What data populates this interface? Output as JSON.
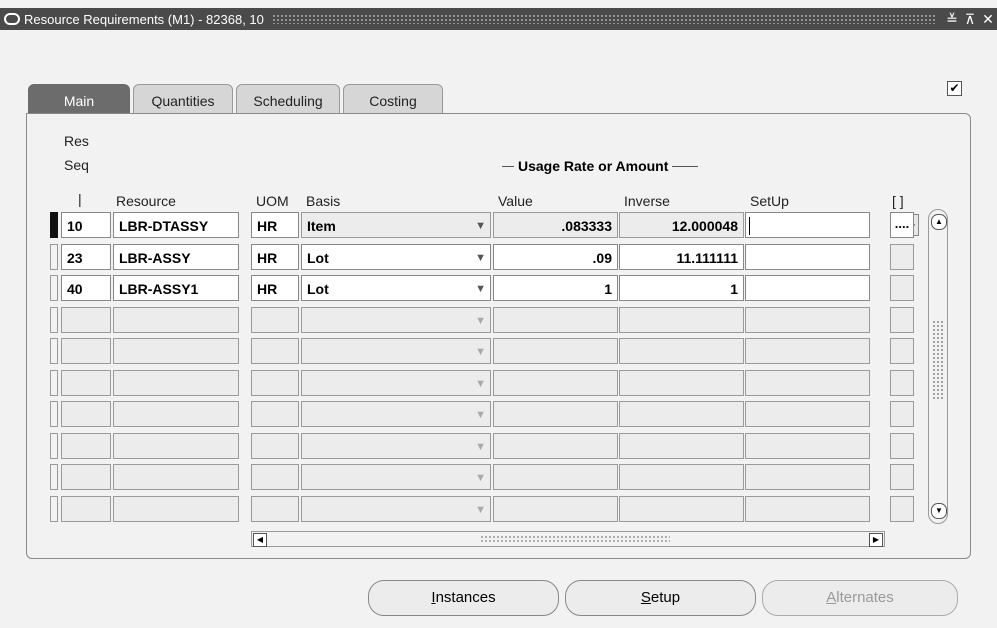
{
  "window": {
    "title": "Resource Requirements (M1) - 82368, 10"
  },
  "tabs": [
    {
      "label": "Main",
      "active": true
    },
    {
      "label": "Quantities",
      "active": false
    },
    {
      "label": "Scheduling",
      "active": false
    },
    {
      "label": "Costing",
      "active": false
    }
  ],
  "columns": {
    "res_seq_line1": "Res",
    "res_seq_line2": "Seq",
    "resource": "Resource",
    "uom": "UOM",
    "basis": "Basis",
    "group_label": "Usage Rate or Amount",
    "value": "Value",
    "inverse": "Inverse",
    "setup": "SetUp",
    "ext": "[ ]",
    "seq_marker": "|"
  },
  "rows": [
    {
      "seq": "10",
      "resource": "LBR-DTASSY",
      "uom": "HR",
      "basis": "Item",
      "value": ".083333",
      "inverse": "12.000048",
      "setup": "",
      "ext": "....",
      "current": true
    },
    {
      "seq": "23",
      "resource": "LBR-ASSY",
      "uom": "HR",
      "basis": "Lot",
      "value": ".09",
      "inverse": "11.111111",
      "setup": "",
      "ext": "",
      "current": false
    },
    {
      "seq": "40",
      "resource": "LBR-ASSY1",
      "uom": "HR",
      "basis": "Lot",
      "value": "1",
      "inverse": "1",
      "setup": "",
      "ext": "",
      "current": false
    },
    {
      "seq": "",
      "resource": "",
      "uom": "",
      "basis": "",
      "value": "",
      "inverse": "",
      "setup": "",
      "ext": "",
      "current": false
    },
    {
      "seq": "",
      "resource": "",
      "uom": "",
      "basis": "",
      "value": "",
      "inverse": "",
      "setup": "",
      "ext": "",
      "current": false
    },
    {
      "seq": "",
      "resource": "",
      "uom": "",
      "basis": "",
      "value": "",
      "inverse": "",
      "setup": "",
      "ext": "",
      "current": false
    },
    {
      "seq": "",
      "resource": "",
      "uom": "",
      "basis": "",
      "value": "",
      "inverse": "",
      "setup": "",
      "ext": "",
      "current": false
    },
    {
      "seq": "",
      "resource": "",
      "uom": "",
      "basis": "",
      "value": "",
      "inverse": "",
      "setup": "",
      "ext": "",
      "current": false
    },
    {
      "seq": "",
      "resource": "",
      "uom": "",
      "basis": "",
      "value": "",
      "inverse": "",
      "setup": "",
      "ext": "",
      "current": false
    },
    {
      "seq": "",
      "resource": "",
      "uom": "",
      "basis": "",
      "value": "",
      "inverse": "",
      "setup": "",
      "ext": "",
      "current": false
    }
  ],
  "buttons": {
    "instances": {
      "pre": "",
      "key": "I",
      "post": "nstances"
    },
    "setup": {
      "pre": "",
      "key": "S",
      "post": "etup"
    },
    "alternates": {
      "pre": "",
      "key": "A",
      "post": "lternates"
    }
  },
  "icons": {
    "window": "window-icon",
    "minimize": "minimize-icon",
    "maximize": "maximize-icon",
    "close": "close-icon",
    "checkbox": "checkbox-checked-icon",
    "dropdown": "dropdown-arrow-icon",
    "lov": "list-of-values-icon"
  },
  "glyphs": {
    "minimize": "≚",
    "maximize": "⊼",
    "close": "✕",
    "check": "✔",
    "dropdown": "▼",
    "lov": "···",
    "scroll_up": "▲",
    "scroll_down": "▼",
    "scroll_left": "◀",
    "scroll_right": "▶"
  },
  "colors": {
    "titlebar": "#4a4a4a",
    "active_tab": "#6c6c6c",
    "panel": "#f2f2f2"
  }
}
